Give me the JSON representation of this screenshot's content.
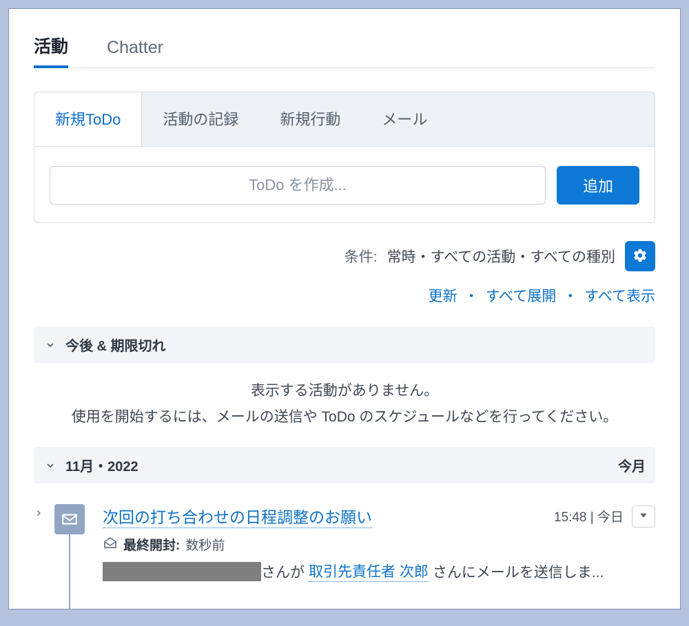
{
  "top_tabs": {
    "activity": "活動",
    "chatter": "Chatter"
  },
  "composer": {
    "tabs": {
      "new_todo": "新規ToDo",
      "log_activity": "活動の記録",
      "new_event": "新規行動",
      "email": "メール"
    },
    "placeholder": "ToDo を作成...",
    "add_button": "追加"
  },
  "filter": {
    "label": "条件: ",
    "value": "常時・すべての活動・すべての種別"
  },
  "links": {
    "refresh": "更新",
    "expand_all": "すべて展開",
    "view_all": "すべて表示"
  },
  "sections": {
    "upcoming": {
      "title": "今後 & 期限切れ"
    },
    "empty_line1": "表示する活動がありません。",
    "empty_line2": "使用を開始するには、メールの送信や ToDo のスケジュールなどを行ってください。",
    "month": {
      "title": "11月・2022",
      "badge": "今月"
    }
  },
  "item": {
    "subject": "次回の打ち合わせの日程調整のお願い",
    "time": "15:48 | 今日",
    "open_label": "最終開封:",
    "open_value": " 数秒前",
    "desc_prefix": " さんが ",
    "contact": "取引先責任者 次郎",
    "desc_suffix": " さんにメールを送信しま..."
  }
}
